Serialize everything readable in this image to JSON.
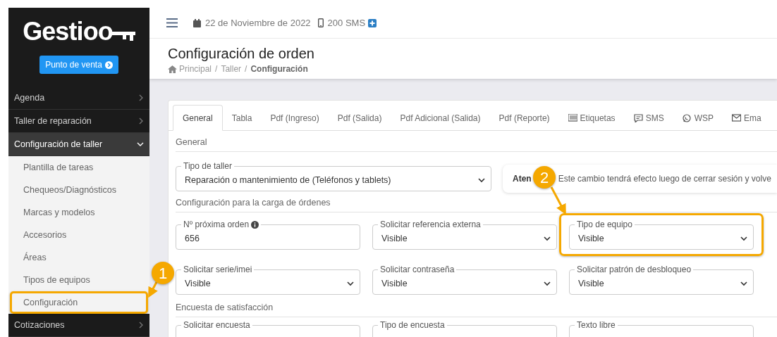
{
  "sidebar": {
    "logo": "Gestioo",
    "pos_button": "Punto de venta",
    "menu": [
      {
        "label": "Agenda",
        "expanded": false
      },
      {
        "label": "Taller de reparación",
        "expanded": false
      },
      {
        "label": "Configuración de taller",
        "expanded": true,
        "children": [
          {
            "label": "Plantilla de tareas"
          },
          {
            "label": "Chequeos/Diagnósticos"
          },
          {
            "label": "Marcas y modelos"
          },
          {
            "label": "Accesorios"
          },
          {
            "label": "Áreas"
          },
          {
            "label": "Tipos de equipos"
          },
          {
            "label": "Configuración"
          }
        ]
      },
      {
        "label": "Cotizaciones",
        "expanded": false
      }
    ]
  },
  "topbar": {
    "date": "22 de Noviembre de 2022",
    "sms": "200 SMS"
  },
  "header": {
    "title": "Configuración de orden",
    "breadcrumbs": [
      "Principal",
      "Taller",
      "Configuración"
    ],
    "separator": "/"
  },
  "tabs": [
    {
      "label": "General",
      "selected": true
    },
    {
      "label": "Tabla",
      "selected": false
    },
    {
      "label": "Pdf (Ingreso)",
      "selected": false
    },
    {
      "label": "Pdf (Salida)",
      "selected": false
    },
    {
      "label": "Pdf Adicional (Salida)",
      "selected": false
    },
    {
      "label": "Pdf (Reporte)",
      "selected": false
    },
    {
      "label": "Etiquetas",
      "selected": false
    },
    {
      "label": "SMS",
      "selected": false
    },
    {
      "label": "WSP",
      "selected": false
    },
    {
      "label": "Ema",
      "selected": false
    }
  ],
  "sections": [
    {
      "title": "General",
      "fields": [
        {
          "kind": "select",
          "label": "Tipo de taller",
          "value": "Reparación o mantenimiento de (Teléfonos y tablets)"
        }
      ],
      "alert": {
        "title": "Aten",
        "message": "Este cambio tendrá efecto luego de cerrar sesión y volve"
      }
    },
    {
      "title": "Configuración para la carga de órdenes",
      "fields": [
        {
          "kind": "input",
          "label": "Nº próxima orden",
          "info": true,
          "value": "656"
        },
        {
          "kind": "select",
          "label": "Solicitar referencia externa",
          "value": "Visible"
        },
        {
          "kind": "select",
          "label": "Tipo de equipo",
          "value": "Visible"
        },
        {
          "kind": "select",
          "label": "Solicitar serie/imei",
          "value": "Visible"
        },
        {
          "kind": "select",
          "label": "Solicitar contraseña",
          "value": "Visible"
        },
        {
          "kind": "select",
          "label": "Solicitar patrón de desbloqueo",
          "value": "Visible"
        }
      ]
    },
    {
      "title": "Encuesta de satisfacción",
      "fields": [
        {
          "kind": "cut",
          "label": "Solicitar encuesta"
        },
        {
          "kind": "cut",
          "label": "Tipo de encuesta"
        },
        {
          "kind": "cut",
          "label": "Texto libre"
        }
      ]
    }
  ],
  "annotations": [
    {
      "label": "1"
    },
    {
      "label": "2"
    }
  ]
}
